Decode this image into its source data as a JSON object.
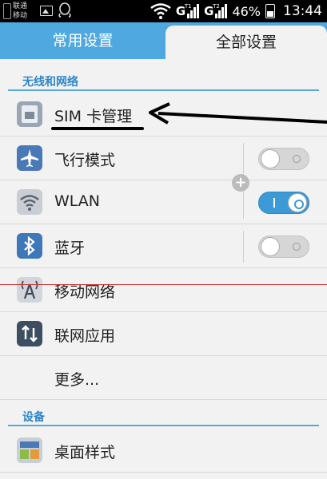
{
  "status_bar": {
    "carrier_line1": "联通",
    "carrier_line2": "移动",
    "signal1_tag": "T1",
    "signal2_tag": "T2",
    "battery_percent": "46%",
    "time": "13:44"
  },
  "tabs": {
    "common": "常用设置",
    "all": "全部设置"
  },
  "sections": {
    "wireless": "无线和网络",
    "device": "设备"
  },
  "items": {
    "sim": "SIM 卡管理",
    "airplane": "飞行模式",
    "wlan": "WLAN",
    "bluetooth": "蓝牙",
    "mobile_network": "移动网络",
    "network_apps": "联网应用",
    "more": "更多...",
    "desktop_style": "桌面样式"
  },
  "toggles": {
    "airplane": "off",
    "wlan": "on",
    "bluetooth": "off"
  },
  "colors": {
    "tab_bar": "#4fa8e0",
    "accent": "#2d86c9",
    "toggle_on": "#3c9ad6"
  }
}
